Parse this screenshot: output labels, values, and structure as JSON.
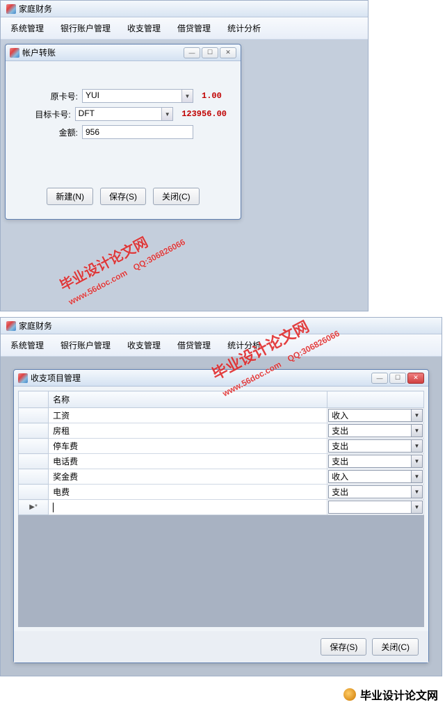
{
  "app1": {
    "title": "家庭财务",
    "menus": [
      "系统管理",
      "银行账户管理",
      "收支管理",
      "借贷管理",
      "统计分析"
    ],
    "transfer_window": {
      "title": "帐户转账",
      "labels": {
        "source_card": "原卡号:",
        "target_card": "目标卡号:",
        "amount": "金额:"
      },
      "values": {
        "source_card": "YUI",
        "source_balance": "1.00",
        "target_card": "DFT",
        "target_balance": "123956.00",
        "amount": "956"
      },
      "buttons": {
        "new": "新建(N)",
        "save": "保存(S)",
        "close": "关闭(C)"
      }
    }
  },
  "app2": {
    "title": "家庭财务",
    "menus": [
      "系统管理",
      "银行账户管理",
      "收支管理",
      "借贷管理",
      "统计分析"
    ],
    "items_window": {
      "title": "收支项目管理",
      "columns": {
        "name": "名称",
        "type": ""
      },
      "rows": [
        {
          "name": "工资",
          "type": "收入"
        },
        {
          "name": "房租",
          "type": "支出"
        },
        {
          "name": "停车费",
          "type": "支出"
        },
        {
          "name": "电话费",
          "type": "支出"
        },
        {
          "name": "奖金费",
          "type": "收入"
        },
        {
          "name": "电费",
          "type": "支出"
        }
      ],
      "new_row_marker": "▶*",
      "buttons": {
        "save": "保存(S)",
        "close": "关闭(C)"
      }
    }
  },
  "watermark": {
    "brand": "毕业设计论文网",
    "url": "www.56doc.com",
    "qq": "QQ:306826066"
  },
  "footer": "毕业设计论文网"
}
